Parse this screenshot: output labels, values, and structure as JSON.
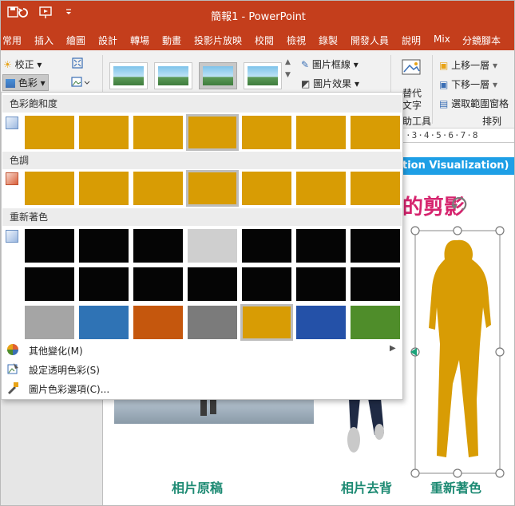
{
  "window": {
    "title": "簡報1 - PowerPoint"
  },
  "tabs": [
    "常用",
    "插入",
    "繪圖",
    "設計",
    "轉場",
    "動畫",
    "投影片放映",
    "校閱",
    "檢視",
    "錄製",
    "開發人員",
    "說明",
    "Mix",
    "分鏡腳本"
  ],
  "ribbon": {
    "corrections_label": "校正",
    "color_label": "色彩",
    "picture_border_label": "圖片框線",
    "picture_effects_label": "圖片效果",
    "alt_text_label_line1": "替代",
    "alt_text_label_line2": "文字",
    "accessibility_group": "助工具",
    "bring_forward_label": "上移一層",
    "send_backward_label": "下移一層",
    "selection_pane_label": "選取範圍窗格",
    "arrange_group": "排列"
  },
  "panel": {
    "saturation_header": "色彩飽和度",
    "tone_header": "色調",
    "recolor_header": "重新著色",
    "more_variations": "其他變化(M)",
    "set_transparent": "設定透明色彩(S)",
    "picture_color_options": "圖片色彩選項(C)..."
  },
  "swatches": {
    "saturation": [
      "#d89c04",
      "#d89c04",
      "#d89c04",
      "#d89c04",
      "#d89c04",
      "#d89c04",
      "#d89c04"
    ],
    "saturation_selected": 3,
    "tone": [
      "#d89c04",
      "#d89c04",
      "#d89c04",
      "#d89c04",
      "#d89c04",
      "#d89c04",
      "#d89c04"
    ],
    "tone_selected": 3,
    "recolor_row1": [
      "#050505",
      "#050505",
      "#050505",
      "#cfcfcf",
      "#050505",
      "#050505",
      "#050505"
    ],
    "recolor_row2": [
      "#050505",
      "#050505",
      "#050505",
      "#050505",
      "#050505",
      "#050505",
      "#050505"
    ],
    "recolor_row3": [
      "#a5a5a5",
      "#2f73b5",
      "#c5570d",
      "#7b7b7b",
      "#d89c04",
      "#2451a8",
      "#4f8d2a"
    ],
    "recolor_selected": 4
  },
  "ruler": {
    "text": "·3·4·5·6·7·8"
  },
  "slide": {
    "banner_text": "tion Visualization)",
    "title_fragment": "的剪影",
    "caption_original": "相片原稿",
    "caption_removed_bg": "相片去背",
    "caption_recolor": "重新著色",
    "silhouette_color": "#d89c04"
  }
}
